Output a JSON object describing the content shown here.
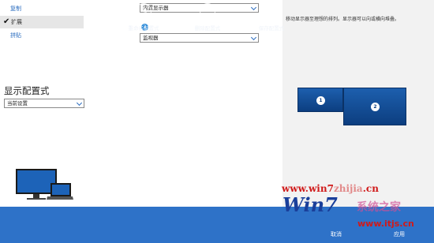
{
  "display_modes": [
    {
      "label": "复制",
      "selected": false
    },
    {
      "label": "扩展",
      "selected": true
    },
    {
      "label": "拼贴",
      "selected": false
    }
  ],
  "display_config": {
    "title": "显示配置式",
    "selected": "当前设置"
  },
  "displays": [
    {
      "number": "",
      "selected": "内置显示器"
    },
    {
      "number": "2",
      "selected": "监视器"
    }
  ],
  "arrange": {
    "hint": "移动显示器至理想的排列。显示器可以向或横向堆叠。",
    "monitors": [
      "1",
      "2"
    ]
  },
  "app_bar": {
    "rename_label": "重命名配置式",
    "delete_label": "删除配置式",
    "save_label": "保存配置式",
    "cancel_label": "取消",
    "apply_label": "应用"
  },
  "watermark": {
    "url_a": "www.win7",
    "url_b": "zhijia",
    "url_c": ".cn",
    "cn_text": "系统之家",
    "logo": "Win7",
    "url2": "www.itjs.cn"
  },
  "colors": {
    "accent": "#2e72c8",
    "monitor_blue": "#0c3e80",
    "link_blue": "#2a6cbf"
  }
}
